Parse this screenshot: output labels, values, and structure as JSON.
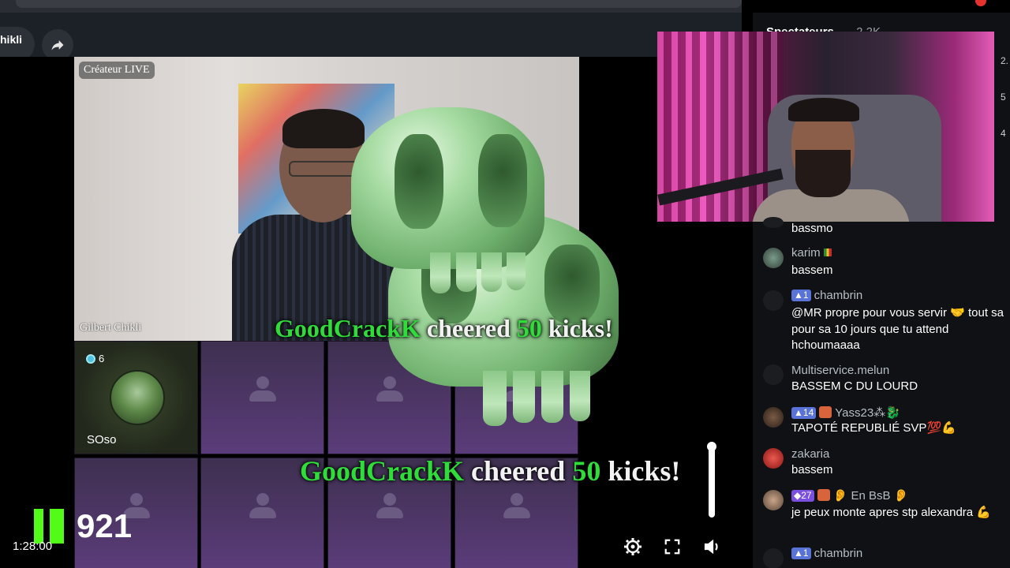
{
  "stream": {
    "streamer_name_partial": "hikli",
    "camera_tag": "Créateur LIVE",
    "camera_name": "Gilbert Chikli",
    "guest_badge_count": "6",
    "guest_name": "SOso",
    "cheer": {
      "user": "GoodCrackK",
      "verb": "cheered",
      "amount": "50",
      "unit": "kicks!"
    },
    "kick_count": "921",
    "elapsed": "1:28:00"
  },
  "icons": {
    "share": "share-arrow-icon",
    "settings": "gear-icon",
    "fullscreen": "fullscreen-icon",
    "volume": "volume-icon"
  },
  "chat": {
    "title": "Spectateurs",
    "viewer_count": "· 2,2K",
    "side_numbers": [
      "2.",
      "5",
      "4"
    ],
    "messages": [
      {
        "user": "",
        "text": "bassmo"
      },
      {
        "user": "karim",
        "text": "bassem"
      },
      {
        "user": "chambrin",
        "badge": "1",
        "text": "@MR propre pour vous servir 🤝 tout sa pour sa 10 jours que tu attend hchoumaaaa"
      },
      {
        "user": "Multiservice.melun",
        "text": "BASSEM C DU LOURD"
      },
      {
        "user": "Yass23⁂🐉",
        "badge": "14",
        "text": "TAPOTÉ REPUBLIÉ SVP💯💪"
      },
      {
        "user": "zakaria",
        "text": "bassem"
      },
      {
        "user": "👂 En BsB 👂",
        "badge": "27",
        "text": "je peux monte apres stp alexandra 💪"
      },
      {
        "user": "chambrin",
        "badge": "1",
        "text": ""
      }
    ]
  },
  "colors": {
    "kick_green": "#53fc18",
    "cheer_green": "#2fdc3a",
    "chat_bg": "#0f1114"
  }
}
